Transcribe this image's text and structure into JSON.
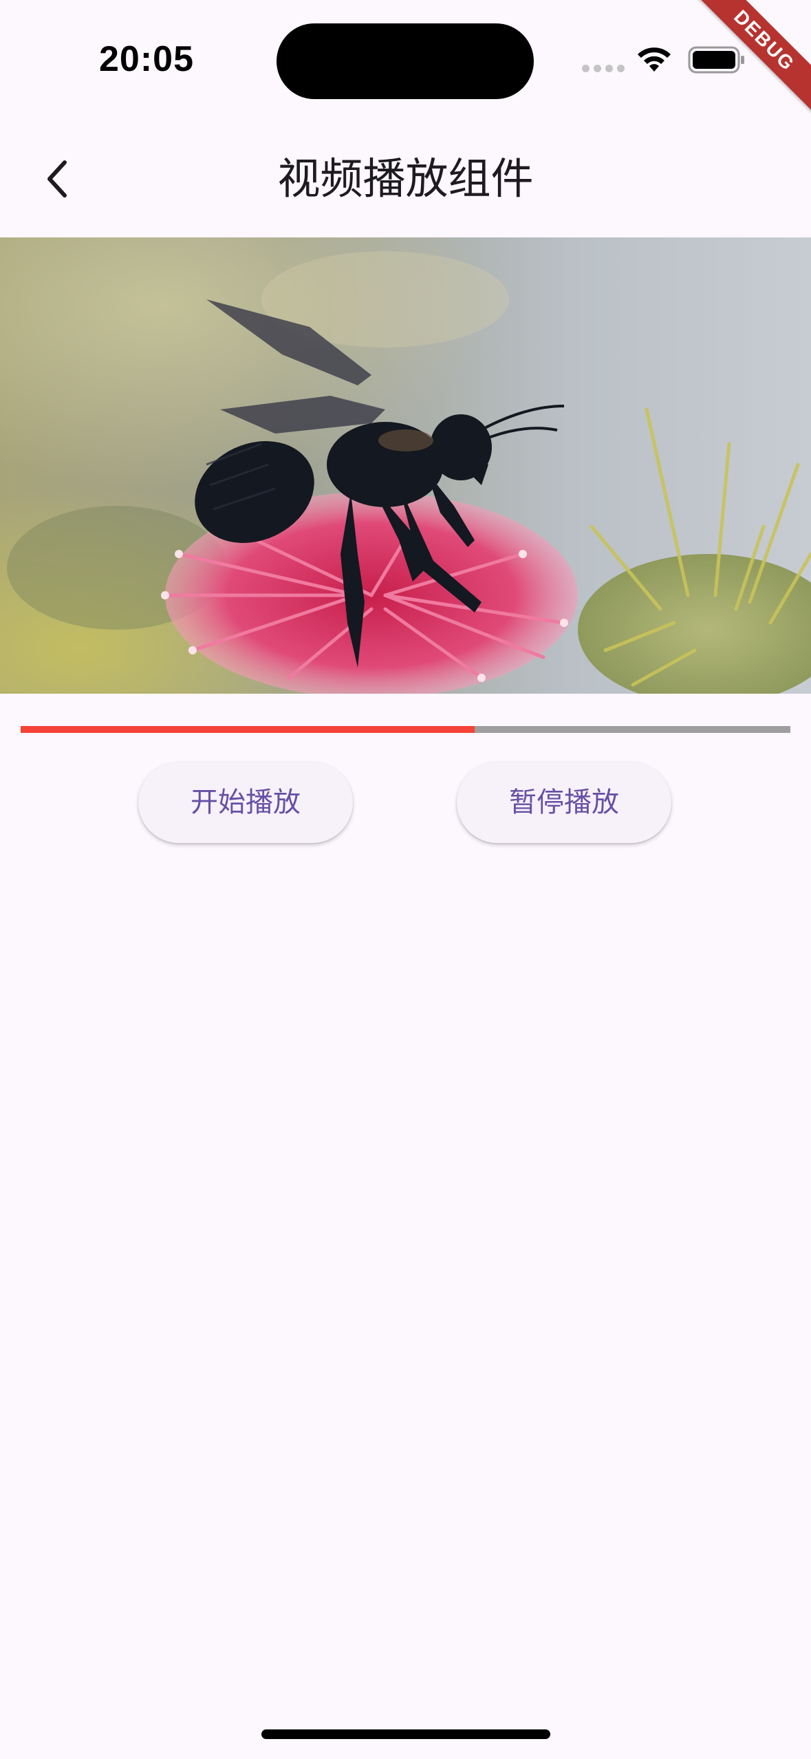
{
  "status_bar": {
    "time": "20:05",
    "debug_label": "DEBUG"
  },
  "app_bar": {
    "title": "视频播放组件",
    "back_icon": "chevron-left-icon"
  },
  "video": {
    "subject": "video-frame",
    "progress_fraction": 0.59
  },
  "controls": {
    "play_label": "开始播放",
    "pause_label": "暂停播放"
  },
  "colors": {
    "background": "#fdf7fe",
    "progress_played": "#f44336",
    "progress_remaining": "#9e9e9e",
    "button_text": "#6750a4",
    "button_bg": "#f7f2fa"
  }
}
